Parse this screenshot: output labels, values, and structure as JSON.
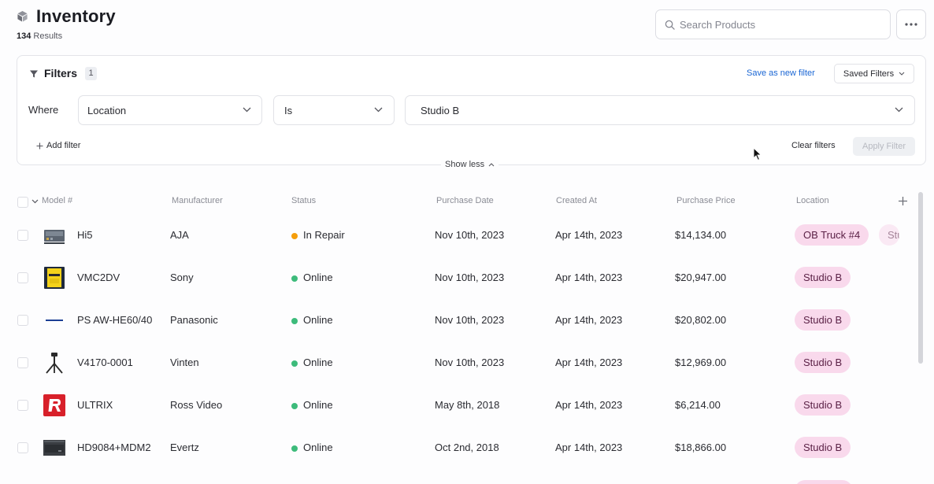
{
  "header": {
    "title": "Inventory",
    "results_count": "134",
    "results_label": "Results",
    "search_placeholder": "Search Products"
  },
  "filters": {
    "title": "Filters",
    "count": "1",
    "save_label": "Save as new filter",
    "saved_filters_label": "Saved Filters",
    "where_label": "Where",
    "field": "Location",
    "operator": "Is",
    "value": "Studio B",
    "add_filter_label": "Add filter",
    "clear_label": "Clear filters",
    "apply_label": "Apply Filter",
    "show_less_label": "Show less"
  },
  "table": {
    "columns": [
      "Model #",
      "Manufacturer",
      "Status",
      "Purchase Date",
      "Created At",
      "Purchase Price",
      "Location"
    ],
    "rows": [
      {
        "model": "Hi5",
        "manufacturer": "AJA",
        "status": "In Repair",
        "status_color": "#f59e0b",
        "purchase_date": "Nov 10th, 2023",
        "created_at": "Apr 14th, 2023",
        "price": "$14,134.00",
        "location": "OB Truck #4",
        "location2": "Stu",
        "thumb": "device-thumb"
      },
      {
        "model": "VMC2DV",
        "manufacturer": "Sony",
        "status": "Online",
        "status_color": "#3dbb7b",
        "purchase_date": "Nov 10th, 2023",
        "created_at": "Apr 14th, 2023",
        "price": "$20,947.00",
        "location": "Studio B",
        "thumb": "box-thumb"
      },
      {
        "model": "PS AW-HE60/40",
        "manufacturer": "Panasonic",
        "status": "Online",
        "status_color": "#3dbb7b",
        "purchase_date": "Nov 10th, 2023",
        "created_at": "Apr 14th, 2023",
        "price": "$20,802.00",
        "location": "Studio B",
        "thumb": "panasonic-logo"
      },
      {
        "model": "V4170-0001",
        "manufacturer": "Vinten",
        "status": "Online",
        "status_color": "#3dbb7b",
        "purchase_date": "Nov 10th, 2023",
        "created_at": "Apr 14th, 2023",
        "price": "$12,969.00",
        "location": "Studio B",
        "thumb": "tripod-thumb"
      },
      {
        "model": "ULTRIX",
        "manufacturer": "Ross Video",
        "status": "Online",
        "status_color": "#3dbb7b",
        "purchase_date": "May 8th, 2018",
        "created_at": "Apr 14th, 2023",
        "price": "$6,214.00",
        "location": "Studio B",
        "thumb": "ross-logo"
      },
      {
        "model": "HD9084+MDM2",
        "manufacturer": "Evertz",
        "status": "Online",
        "status_color": "#3dbb7b",
        "purchase_date": "Oct 2nd, 2018",
        "created_at": "Apr 14th, 2023",
        "price": "$18,866.00",
        "location": "Studio B",
        "thumb": "rack-thumb"
      }
    ]
  },
  "colors": {
    "accent": "#1a66d4",
    "tag_bg": "#f9d9ec",
    "tag_text": "#5b2146"
  }
}
